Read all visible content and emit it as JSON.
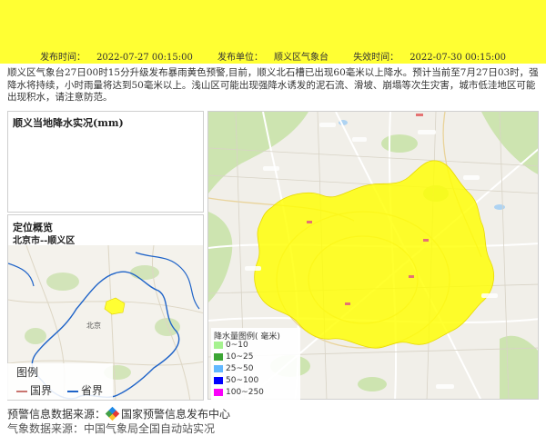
{
  "header": {
    "publish_label": "发布时间：",
    "publish_time": "2022-07-27 00:15:00",
    "unit_label": "发布单位：",
    "unit": "顺义区气象台",
    "expire_label": "失效时间：",
    "expire_time": "2022-07-30 00:15:00",
    "banner_color": "#ffff33"
  },
  "description": "顺义区气象台27日00时15分升级发布暴雨黄色预警,目前，顺义北石槽已出现60毫米以上降水。预计当前至7月27日03时，强降水将持续，小时雨量将达到50毫米以上。浅山区可能出现强降水诱发的泥石流、滑坡、崩塌等次生灾害，城市低洼地区可能出现积水，请注意防范。",
  "rain_panel": {
    "title": "顺义当地降水实况(mm)"
  },
  "location_panel": {
    "title": "定位概览",
    "subtitle": "北京市--顺义区",
    "map_label_beijing": "北京",
    "legend_title": "图例",
    "legend_items": [
      {
        "label": "国界",
        "color": "#c9746f"
      },
      {
        "label": "省界",
        "color": "#1e63c8"
      }
    ]
  },
  "rain_legend": {
    "title": "降水量图例( 毫米)",
    "items": [
      {
        "label": "0~10",
        "color": "#a6f28f"
      },
      {
        "label": "10~25",
        "color": "#3ba534"
      },
      {
        "label": "25~50",
        "color": "#62b8ff"
      },
      {
        "label": "50~100",
        "color": "#0000fe"
      },
      {
        "label": "100~250",
        "color": "#fa00fa"
      }
    ]
  },
  "footer": {
    "source_label": "预警信息数据来源：",
    "source_name": "国家预警信息发布中心",
    "source2": "气象数据来源：中国气象局全国自动站实况"
  }
}
